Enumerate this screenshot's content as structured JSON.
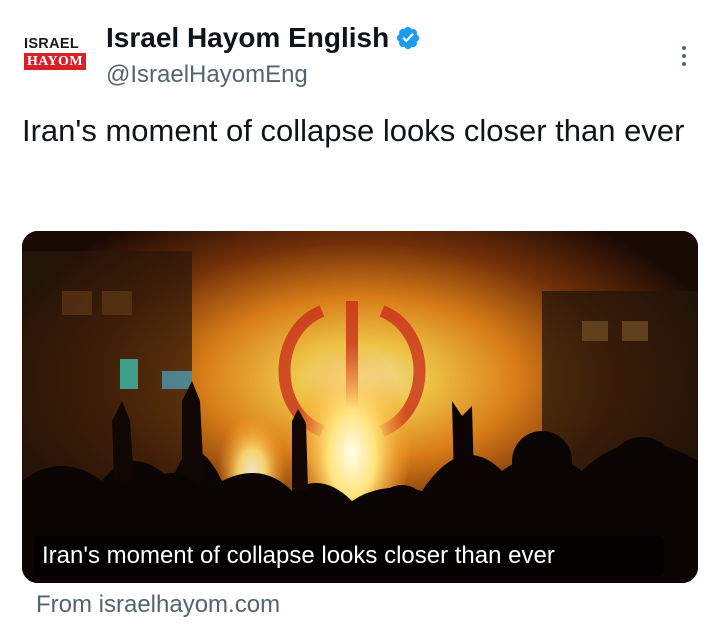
{
  "account": {
    "display_name": "Israel Hayom English",
    "handle": "@IsraelHayomEng",
    "verified": true,
    "avatar_logo_line1": "ISRAEL",
    "avatar_logo_line2": "HAYOM"
  },
  "tweet": {
    "text": "Iran's moment of collapse looks closer than ever"
  },
  "card": {
    "caption": "Iran's moment of collapse looks closer than ever",
    "source": "From israelhayom.com"
  },
  "icons": {
    "verified": "verified-badge-icon",
    "more": "more-options-icon"
  },
  "colors": {
    "verified_badge": "#1d9bf0",
    "logo_red": "#d6202a",
    "secondary_text": "#536471",
    "primary_text": "#0f1419"
  }
}
